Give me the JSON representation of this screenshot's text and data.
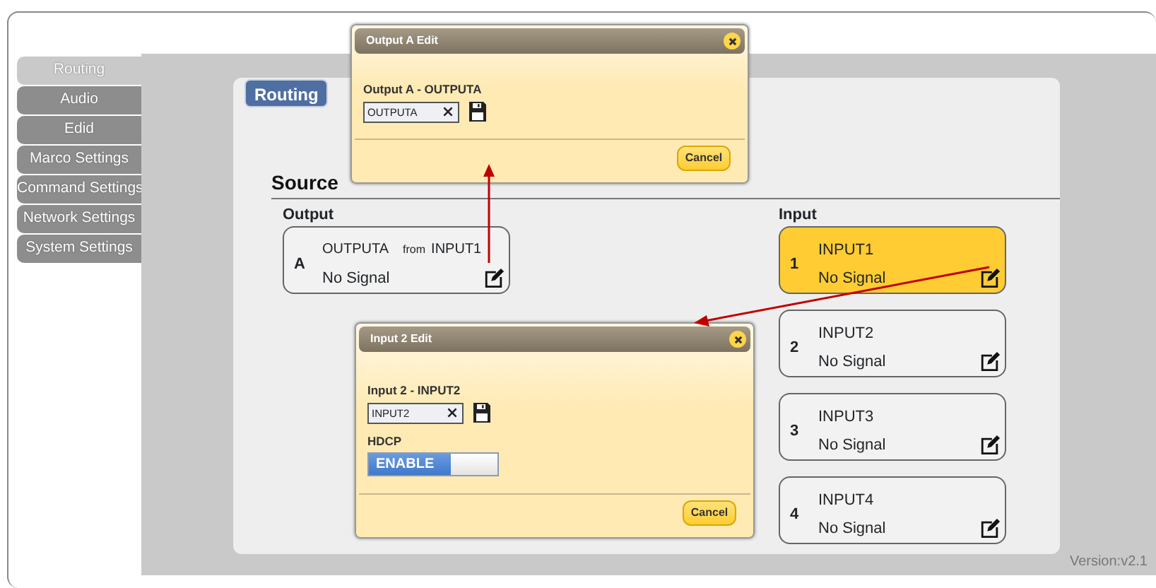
{
  "sidebar": {
    "items": [
      {
        "label": "Routing",
        "selected": true
      },
      {
        "label": "Audio",
        "selected": false
      },
      {
        "label": "Edid",
        "selected": false
      },
      {
        "label": "Marco Settings",
        "selected": false
      },
      {
        "label": "Command Settings",
        "selected": false
      },
      {
        "label": "Network Settings",
        "selected": false
      },
      {
        "label": "System Settings",
        "selected": false
      }
    ]
  },
  "page_tab": "Routing",
  "section_title": "Source",
  "output": {
    "heading": "Output",
    "cards": [
      {
        "letter": "A",
        "name": "OUTPUTA",
        "from_label": "from",
        "source": "INPUT1",
        "signal": "No Signal"
      }
    ]
  },
  "input": {
    "heading": "Input",
    "cards": [
      {
        "number": "1",
        "name": "INPUT1",
        "signal": "No Signal",
        "selected": true
      },
      {
        "number": "2",
        "name": "INPUT2",
        "signal": "No Signal",
        "selected": false
      },
      {
        "number": "3",
        "name": "INPUT3",
        "signal": "No Signal",
        "selected": false
      },
      {
        "number": "4",
        "name": "INPUT4",
        "signal": "No Signal",
        "selected": false
      }
    ]
  },
  "dialogs": [
    {
      "kind": "output",
      "title": "Output A Edit",
      "label": "Output A - OUTPUTA",
      "value": "OUTPUTA",
      "cancel": "Cancel"
    },
    {
      "kind": "input",
      "title": "Input 2 Edit",
      "label": "Input 2 - INPUT2",
      "value": "INPUT2",
      "hdcp_label": "HDCP",
      "toggle": {
        "label": "ENABLE",
        "on": true
      },
      "cancel": "Cancel"
    }
  ],
  "version": "Version:v2.1"
}
